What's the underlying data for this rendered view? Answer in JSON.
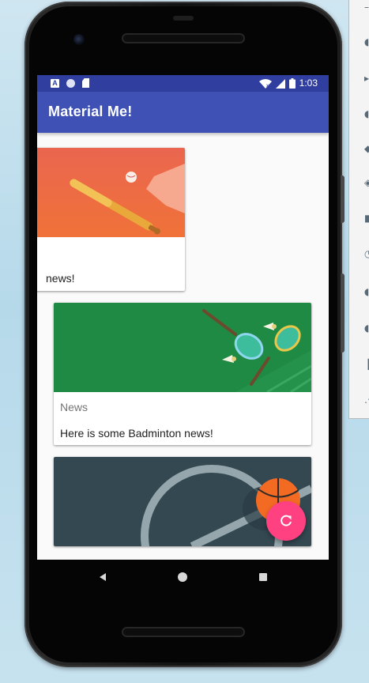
{
  "status_bar": {
    "notification_a": "A",
    "time": "1:03"
  },
  "app_bar": {
    "title": "Material Me!"
  },
  "cards": [
    {
      "sport": "Baseball",
      "subtitle": "",
      "body": "news!"
    },
    {
      "sport": "Badminton",
      "subtitle": "News",
      "body": "Here is some Badminton news!"
    },
    {
      "sport": "Basketball",
      "subtitle": "",
      "body": ""
    }
  ],
  "fab": {
    "icon": "refresh-icon"
  },
  "nav": {
    "back": "back-icon",
    "home": "home-icon",
    "recents": "recents-icon"
  },
  "colors": {
    "status_bar": "#303f9f",
    "app_bar": "#3f51b5",
    "fab": "#ff4081"
  }
}
